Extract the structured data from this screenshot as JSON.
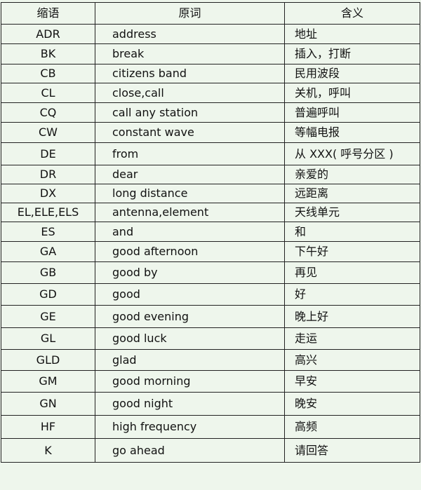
{
  "table": {
    "headers": [
      "缩语",
      "原词",
      "含义"
    ],
    "rows": [
      [
        "ADR",
        "address",
        "地址"
      ],
      [
        "BK",
        "break",
        "插入，打断"
      ],
      [
        "CB",
        "citizens band",
        "民用波段"
      ],
      [
        "CL",
        "close,call",
        "关机，呼叫"
      ],
      [
        "CQ",
        "call any station",
        "普遍呼叫"
      ],
      [
        "CW",
        "constant wave",
        "等幅电报"
      ],
      [
        "DE",
        "from",
        "从 XXX( 呼号分区 )"
      ],
      [
        "DR",
        "dear",
        "亲爱的"
      ],
      [
        "DX",
        "long distance",
        "远距离"
      ],
      [
        "EL,ELE,ELS",
        "antenna,element",
        "天线单元"
      ],
      [
        "ES",
        "and",
        "和"
      ],
      [
        "GA",
        "good afternoon",
        "下午好"
      ],
      [
        "GB",
        "good by",
        "再见"
      ],
      [
        "GD",
        "good",
        "好"
      ],
      [
        "GE",
        "good evening",
        "晚上好"
      ],
      [
        "GL",
        "good luck",
        "走运"
      ],
      [
        "GLD",
        "glad",
        "高兴"
      ],
      [
        "GM",
        "good  morning",
        "早安"
      ],
      [
        "GN",
        "good night",
        "晚安"
      ],
      [
        "HF",
        "high frequency",
        "高频"
      ],
      [
        "K",
        "go ahead",
        "请回答"
      ]
    ]
  }
}
